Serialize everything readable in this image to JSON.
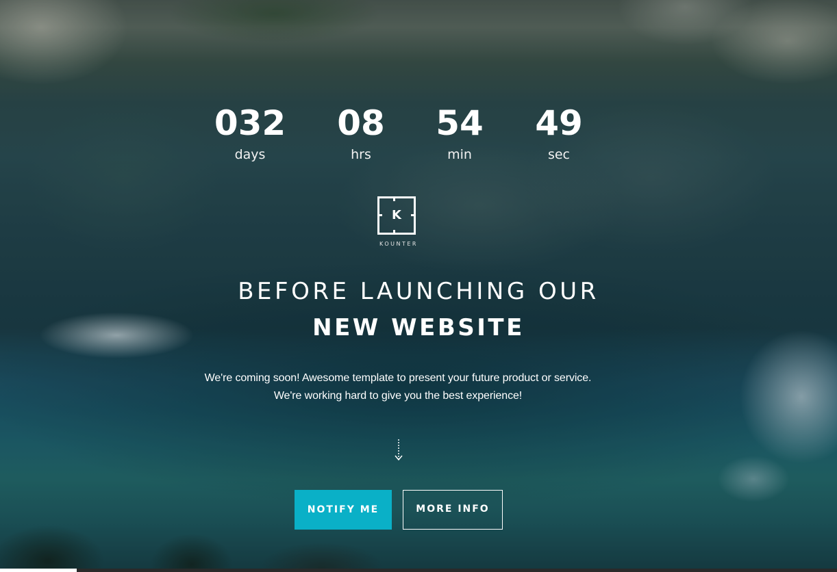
{
  "countdown": {
    "days": {
      "value": "032",
      "label": "days"
    },
    "hours": {
      "value": "08",
      "label": "hrs"
    },
    "minutes": {
      "value": "54",
      "label": "min"
    },
    "seconds": {
      "value": "49",
      "label": "sec"
    }
  },
  "logo": {
    "letter": "K",
    "name": "KOUNTER"
  },
  "headline": {
    "line1": "BEFORE LAUNCHING OUR",
    "line2": "NEW WEBSITE"
  },
  "subtitle": {
    "line1": "We're coming soon! Awesome template to present your future product or service.",
    "line2": "We're working hard to give you the best experience!"
  },
  "buttons": {
    "notify": "NOTIFY ME",
    "more_info": "MORE INFO"
  },
  "colors": {
    "accent": "#0ab0c7",
    "text": "#ffffff"
  },
  "icons": {
    "scroll": "arrow-down-icon",
    "logo": "kounter-logo-icon"
  }
}
